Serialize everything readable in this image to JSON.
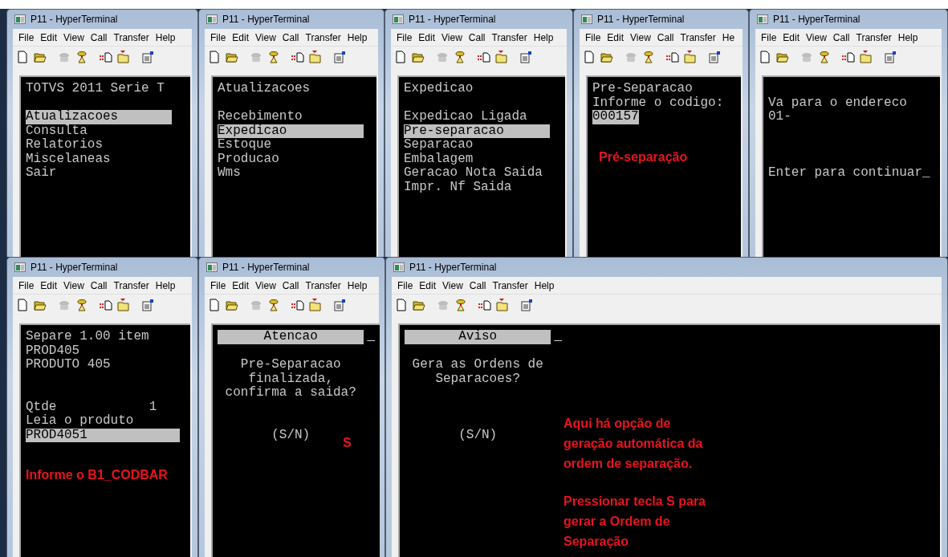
{
  "rows": [
    {
      "windows": [
        {
          "title": "P11 - HyperTerminal",
          "menu": [
            "File",
            "Edit",
            "View",
            "Call",
            "Transfer",
            "Help"
          ],
          "terminal": {
            "lines": [
              {
                "kind": "text",
                "text": "TOTVS 2011 Serie T"
              },
              {
                "kind": "blank"
              },
              {
                "kind": "menu",
                "text": "Atualizacoes",
                "selected": true
              },
              {
                "kind": "menu",
                "text": "Consulta",
                "selected": false
              },
              {
                "kind": "menu",
                "text": "Relatorios",
                "selected": false
              },
              {
                "kind": "menu",
                "text": "Miscelaneas",
                "selected": false
              },
              {
                "kind": "menu",
                "text": "Sair",
                "selected": false
              }
            ]
          }
        },
        {
          "title": "P11 - HyperTerminal",
          "menu": [
            "File",
            "Edit",
            "View",
            "Call",
            "Transfer",
            "Help"
          ],
          "terminal": {
            "lines": [
              {
                "kind": "text",
                "text": "Atualizacoes"
              },
              {
                "kind": "blank"
              },
              {
                "kind": "menu",
                "text": "Recebimento",
                "selected": false
              },
              {
                "kind": "menu",
                "text": "Expedicao",
                "selected": true
              },
              {
                "kind": "menu",
                "text": "Estoque",
                "selected": false
              },
              {
                "kind": "menu",
                "text": "Producao",
                "selected": false
              },
              {
                "kind": "menu",
                "text": "Wms",
                "selected": false
              }
            ]
          }
        },
        {
          "title": "P11 - HyperTerminal",
          "menu": [
            "File",
            "Edit",
            "View",
            "Call",
            "Transfer",
            "Help"
          ],
          "terminal": {
            "lines": [
              {
                "kind": "text",
                "text": "Expedicao"
              },
              {
                "kind": "blank"
              },
              {
                "kind": "menu",
                "text": "Expedicao Ligada",
                "selected": false
              },
              {
                "kind": "menu",
                "text": "Pre-separacao",
                "selected": true
              },
              {
                "kind": "menu",
                "text": "Separacao",
                "selected": false
              },
              {
                "kind": "menu",
                "text": "Embalagem",
                "selected": false
              },
              {
                "kind": "menu",
                "text": "Geracao Nota Saida",
                "selected": false
              },
              {
                "kind": "menu",
                "text": "Impr. Nf Saida",
                "selected": false
              }
            ]
          }
        },
        {
          "title": "P11 - HyperTerminal",
          "menu": [
            "File",
            "Edit",
            "View",
            "Call",
            "Transfer",
            "He"
          ],
          "terminal": {
            "lines": [
              {
                "kind": "text",
                "text": "Pre-Separacao"
              },
              {
                "kind": "text",
                "text": "Informe o codigo:"
              },
              {
                "kind": "value",
                "text": "000157"
              }
            ]
          },
          "notes": [
            "Pré-separação"
          ]
        },
        {
          "title": "P11 - HyperTerminal",
          "menu": [
            "File",
            "Edit",
            "View",
            "Call",
            "Transfer",
            "Help"
          ],
          "terminal": {
            "lines": [
              {
                "kind": "blank"
              },
              {
                "kind": "text",
                "text": "Va para o endereco"
              },
              {
                "kind": "text",
                "text": "01-"
              },
              {
                "kind": "blank"
              },
              {
                "kind": "blank"
              },
              {
                "kind": "blank"
              },
              {
                "kind": "text",
                "text": "Enter para continuar_"
              }
            ]
          }
        }
      ]
    },
    {
      "windows": [
        {
          "title": "P11 - HyperTerminal",
          "menu": [
            "File",
            "Edit",
            "View",
            "Call",
            "Transfer",
            "Help"
          ],
          "terminal": {
            "lines": [
              {
                "kind": "text",
                "text": "Separe 1.00 item"
              },
              {
                "kind": "text",
                "text": "PROD405"
              },
              {
                "kind": "text",
                "text": "PRODUTO 405"
              },
              {
                "kind": "blank"
              },
              {
                "kind": "blank"
              },
              {
                "kind": "text",
                "text": "Qtde            1"
              },
              {
                "kind": "text",
                "text": "Leia o produto"
              },
              {
                "kind": "input",
                "text": "PROD4051"
              }
            ]
          },
          "notes": [
            "Informe o B1_CODBAR"
          ]
        },
        {
          "title": "P11 - HyperTerminal",
          "menu": [
            "File",
            "Edit",
            "View",
            "Call",
            "Transfer",
            "Help"
          ],
          "terminal": {
            "lines": [
              {
                "kind": "header",
                "text": "Atencao",
                "cursor": "_"
              },
              {
                "kind": "blank"
              },
              {
                "kind": "centered",
                "text": "Pre-Separacao"
              },
              {
                "kind": "centered",
                "text": "finalizada,"
              },
              {
                "kind": "centered",
                "text": "confirma a saida?"
              },
              {
                "kind": "blank"
              },
              {
                "kind": "blank"
              },
              {
                "kind": "centered",
                "text": "(S/N)"
              }
            ]
          },
          "notes": [
            "S"
          ]
        },
        {
          "title": "P11 - HyperTerminal",
          "menu": [
            "File",
            "Edit",
            "View",
            "Call",
            "Transfer",
            "Help"
          ],
          "terminal": {
            "lines": [
              {
                "kind": "header",
                "text": "Aviso",
                "cursor": "_"
              },
              {
                "kind": "blank"
              },
              {
                "kind": "centered",
                "text": "Gera as Ordens de"
              },
              {
                "kind": "centered",
                "text": "Separacoes?"
              },
              {
                "kind": "blank"
              },
              {
                "kind": "blank"
              },
              {
                "kind": "blank"
              },
              {
                "kind": "centered",
                "text": "(S/N)"
              }
            ]
          },
          "notes": [
            "Aqui há opção de geração automática da ordem de separação.",
            "Pressionar tecla S para gerar a Ordem de Separação"
          ]
        }
      ]
    }
  ]
}
